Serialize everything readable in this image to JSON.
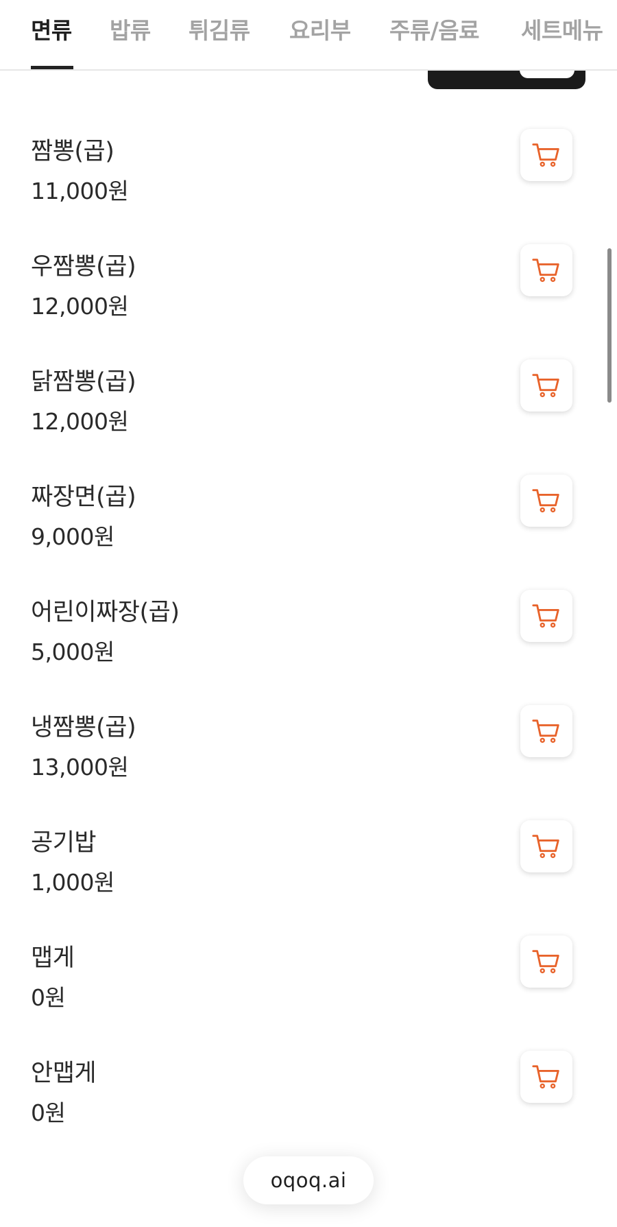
{
  "tabs": [
    {
      "label": "면류",
      "active": true
    },
    {
      "label": "밥류",
      "active": false
    },
    {
      "label": "튀김류",
      "active": false
    },
    {
      "label": "요리부",
      "active": false
    },
    {
      "label": "주류/음료",
      "active": false
    },
    {
      "label": "세트메뉴",
      "active": false
    }
  ],
  "menu": {
    "items": [
      {
        "name": "짬뽕(곱)",
        "price": "11,000원"
      },
      {
        "name": "우짬뽕(곱)",
        "price": "12,000원"
      },
      {
        "name": "닭짬뽕(곱)",
        "price": "12,000원"
      },
      {
        "name": "짜장면(곱)",
        "price": "9,000원"
      },
      {
        "name": "어린이짜장(곱)",
        "price": "5,000원"
      },
      {
        "name": "냉짬뽕(곱)",
        "price": "13,000원"
      },
      {
        "name": "공기밥",
        "price": "1,000원"
      },
      {
        "name": "맵게",
        "price": "0원"
      },
      {
        "name": "안맵게",
        "price": "0원"
      }
    ],
    "cart_icon": "shopping-cart-icon"
  },
  "footer": {
    "brand": "oqoq.ai"
  },
  "colors": {
    "accent": "#e8632b",
    "text": "#2a2a2a",
    "tab_inactive": "#a3a3a3"
  }
}
